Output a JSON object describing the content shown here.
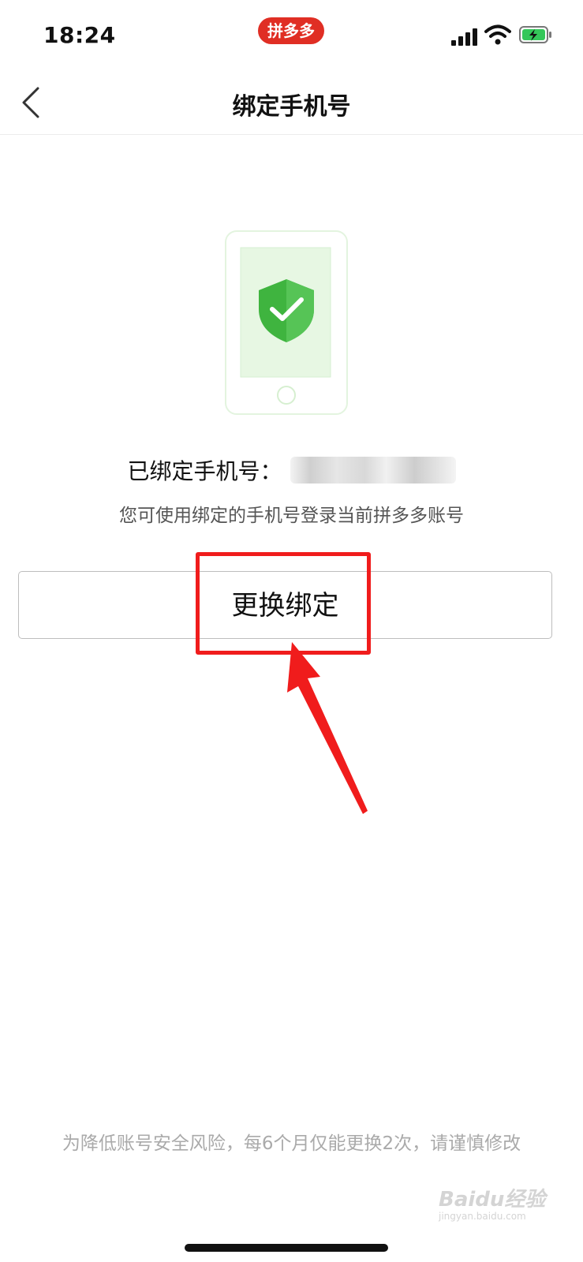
{
  "status_bar": {
    "time": "18:24",
    "app_badge": "拼多多",
    "icons": [
      "cellular-signal-icon",
      "wifi-icon",
      "battery-charging-icon"
    ]
  },
  "nav": {
    "title": "绑定手机号",
    "back_icon": "chevron-left-icon"
  },
  "main": {
    "illustration_icon": "phone-shield-check-icon",
    "bound_label": "已绑定手机号：",
    "description": "您可使用绑定的手机号登录当前拼多多账号",
    "change_button_label": "更换绑定"
  },
  "footer": {
    "note": "为降低账号安全风险，每6个月仅能更换2次，请谨慎修改"
  },
  "watermark": {
    "text": "Baidu经验",
    "subtext": "jingyan.baidu.com"
  },
  "colors": {
    "brand_red": "#e02e24",
    "annotation_red": "#f01c1c",
    "shield_green": "#3fb43f"
  }
}
